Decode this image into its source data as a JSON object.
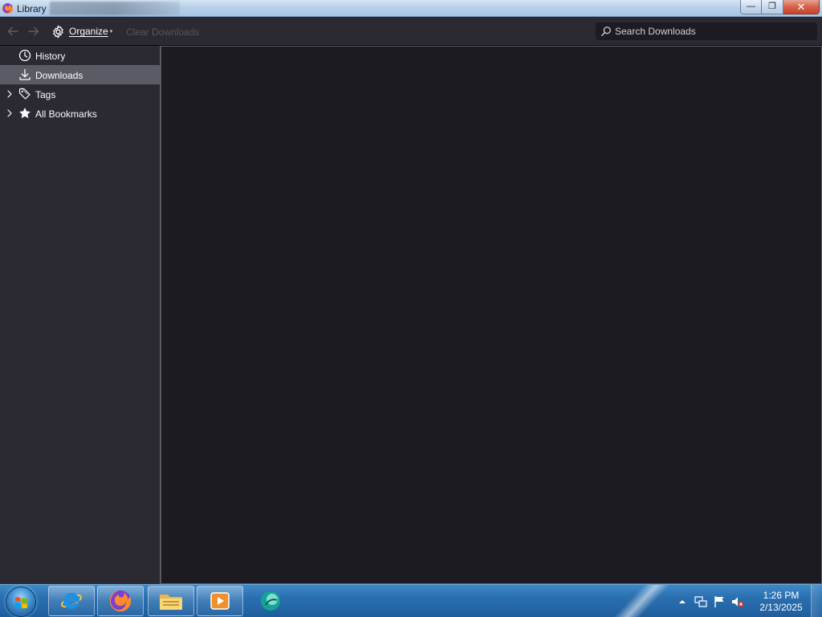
{
  "window": {
    "title": "Library",
    "buttons": {
      "minimize": "—",
      "restore": "❐",
      "close": "✕"
    }
  },
  "toolbar": {
    "back_icon": "back-arrow-icon",
    "forward_icon": "forward-arrow-icon",
    "organize_label": "Organize",
    "organize_caret": "▾",
    "clear_downloads_label": "Clear Downloads",
    "search": {
      "placeholder": "Search Downloads",
      "value": ""
    }
  },
  "sidebar": {
    "items": [
      {
        "label": "History",
        "icon": "clock-icon",
        "expandable": false,
        "selected": false
      },
      {
        "label": "Downloads",
        "icon": "download-icon",
        "expandable": false,
        "selected": true
      },
      {
        "label": "Tags",
        "icon": "tag-icon",
        "expandable": true,
        "selected": false
      },
      {
        "label": "All Bookmarks",
        "icon": "star-icon",
        "expandable": true,
        "selected": false
      }
    ]
  },
  "taskbar": {
    "pinned": [
      "internet-explorer-icon",
      "firefox-icon",
      "file-explorer-icon",
      "media-player-icon",
      "app-icon"
    ],
    "clock": {
      "time": "1:26 PM",
      "date": "2/13/2025"
    }
  },
  "colors": {
    "toolbar_bg": "#2b2a33",
    "content_bg": "#1c1b22",
    "selected_bg": "#5b5b66",
    "text": "#fbfbfe",
    "disabled_text": "#56555d",
    "taskbar": "#2a6fb0"
  }
}
